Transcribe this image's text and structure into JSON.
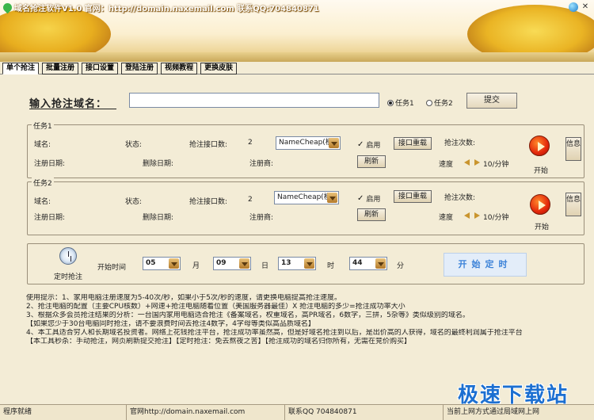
{
  "window": {
    "title": "域名抢注软件V1.0 官网：http://domain.naxemail.com 联系QQ:704840871",
    "globe_icon": "globe-icon",
    "close_label": "✕"
  },
  "tabs": [
    {
      "label": "单个抢注",
      "active": true
    },
    {
      "label": "批量注册",
      "active": false
    },
    {
      "label": "接口设置",
      "active": false
    },
    {
      "label": "登陆注册",
      "active": false
    },
    {
      "label": "视频教程",
      "active": false
    },
    {
      "label": "更换皮肤",
      "active": false
    }
  ],
  "domain_form": {
    "label": "输入抢注域名：",
    "input_value": "",
    "radio1": "任务1",
    "radio2": "任务2",
    "submit": "提交"
  },
  "tasks": [
    {
      "title": "任务1",
      "domain_label": "域名:",
      "status_label": "状态:",
      "api_count_label": "抢注接口数:",
      "api_count": "2",
      "api_select": "NameCheap(模)",
      "enable_label": "启用",
      "reload_btn": "接口重载",
      "attempts_label": "抢注次数:",
      "reg_date_label": "注册日期:",
      "del_date_label": "删除日期:",
      "registrar_label": "注册商:",
      "refresh_btn": "刷新",
      "speed_label": "速度",
      "speed_value": "10/分钟",
      "start_label": "开始",
      "info_btn": "信息"
    },
    {
      "title": "任务2",
      "domain_label": "域名:",
      "status_label": "状态:",
      "api_count_label": "抢注接口数:",
      "api_count": "2",
      "api_select": "NameCheap(模)",
      "enable_label": "启用",
      "reload_btn": "接口重载",
      "attempts_label": "抢注次数:",
      "reg_date_label": "注册日期:",
      "del_date_label": "删除日期:",
      "registrar_label": "注册商:",
      "refresh_btn": "刷新",
      "speed_label": "速度",
      "speed_value": "10/分钟",
      "start_label": "开始",
      "info_btn": "信息"
    }
  ],
  "timer": {
    "label": "定时抢注",
    "start_time_label": "开始时间",
    "month": "05",
    "month_unit": "月",
    "day": "09",
    "day_unit": "日",
    "hour": "13",
    "hour_unit": "时",
    "minute": "44",
    "minute_unit": "分",
    "start_btn": "开始定时"
  },
  "notes": [
    "使用提示：1、家用电脑注册速度为5-40次/秒，如果小于5次/秒的速度，请更换电脑提高抢注速度。",
    "2、抢注电脑的配置（主要CPU核数）+网速+抢注电脑随着位置（美国服务器最佳）X 抢注电脑的多少=抢注成功率大小",
    "3、根据众多会员抢注结果的分析：一台国内家用电脑适合抢注《备案域名，权重域名，高PR域名，6数字，三拼，5杂等》类似级别的域名。",
    "【如果您少于30台电脑同时抢注，请不要浪费时间去抢注4数字，4字母等类似高品质域名】",
    "4、本工具适合穷人和长期域名投资者。网络上花钱抢注平台，抢注成功率虽然高，但是好域名抢注到以后，是出价高的人获得，域名的最终利润属于抢注平台",
    "【本工具秒杀：手动抢注，网页刷新提交抢注】【定时抢注：免去熬夜之苦】【抢注成功的域名归你所有，无需在竞价购买】"
  ],
  "watermark": "极速下载站",
  "statusbar": {
    "state": "程序就绪",
    "website": "官网http://domain.naxemail.com",
    "qq": "联系QQ 704840871",
    "network": "当前上网方式通过局域网上网"
  }
}
